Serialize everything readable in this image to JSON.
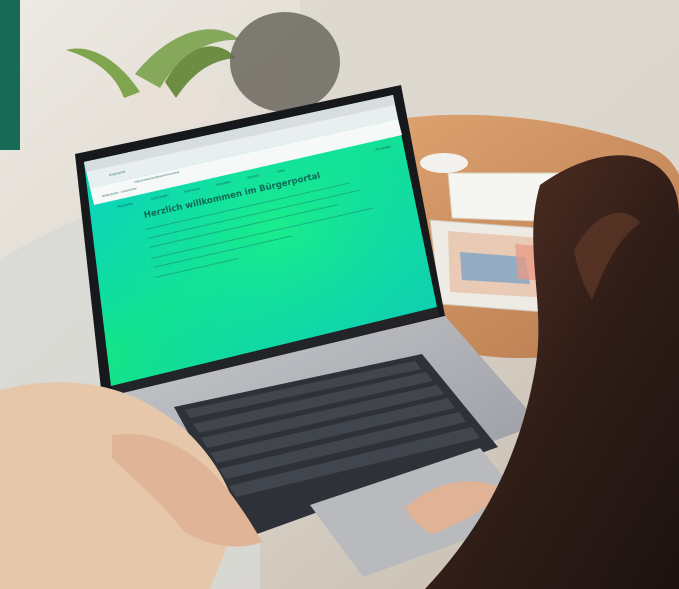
{
  "screen": {
    "tab_title": "Bürgerportal",
    "address": "https://www.buergerportal.example",
    "bookmark_hint": "Bürgerportal – Lesezeichen",
    "nav_items": [
      "Startseite",
      "Leistungen",
      "Formulare",
      "Aktuelles",
      "Kontakt",
      "Hilfe"
    ],
    "login_label": "Anmelden",
    "headline": "Herzlich willkommen im Bürgerportal"
  },
  "colors": {
    "accent_green": "#176a55",
    "screen_cyan": "#09d8c9",
    "screen_green": "#15df7f",
    "laptop_silver": "#aeb0b5",
    "keyboard_dark": "#2e3137"
  }
}
